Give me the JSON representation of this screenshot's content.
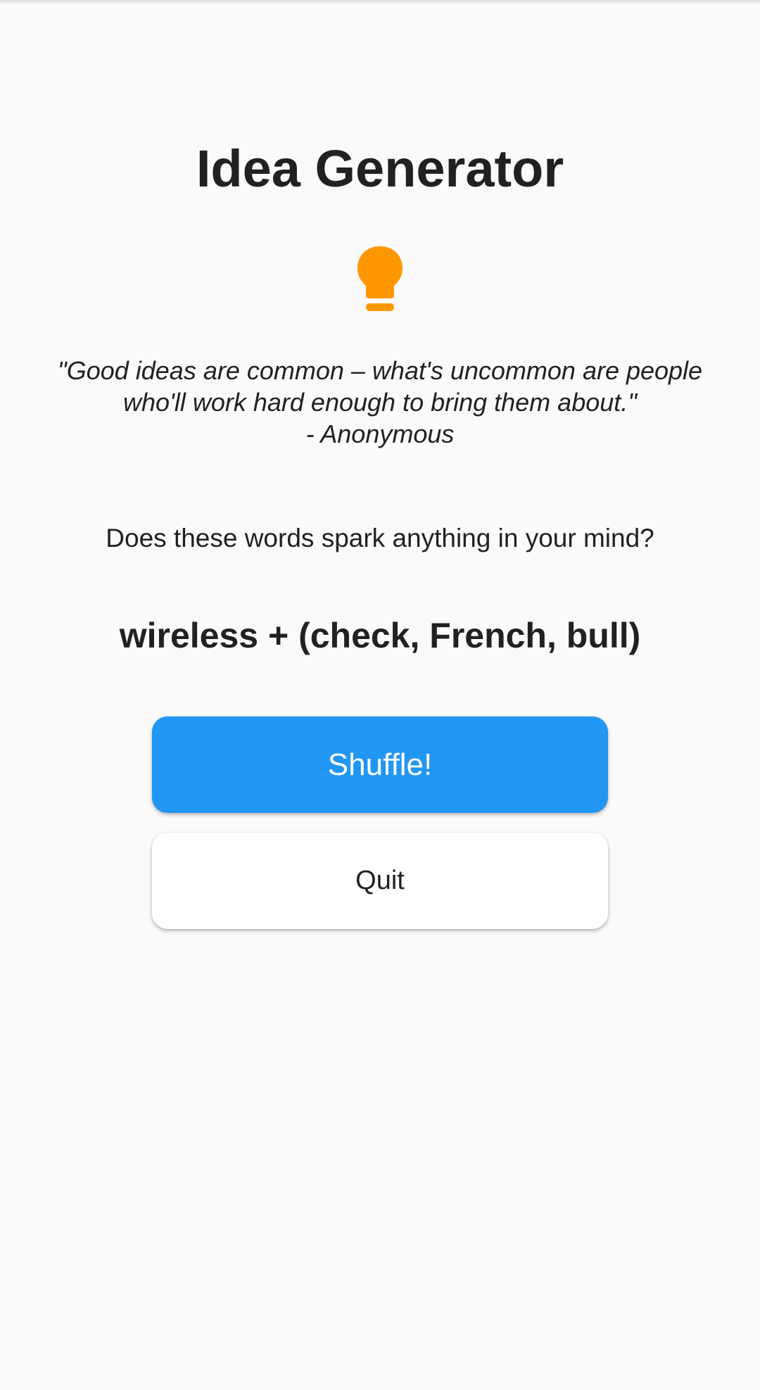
{
  "app": {
    "title": "Idea Generator"
  },
  "header_icon": {
    "name": "lightbulb-icon",
    "color": "#ff9800"
  },
  "quote": {
    "line1": "\"Good ideas are common – what's uncommon are people",
    "line2": "who'll work hard enough to bring them about.\"",
    "author": "- Anonymous"
  },
  "prompt": "Does these words spark anything in your mind?",
  "words": "wireless + (check, French, bull)",
  "buttons": {
    "shuffle_label": "Shuffle!",
    "quit_label": "Quit"
  },
  "colors": {
    "background": "#fafafa",
    "primary": "#2196f3",
    "accent": "#ff9800",
    "text": "#212121"
  }
}
